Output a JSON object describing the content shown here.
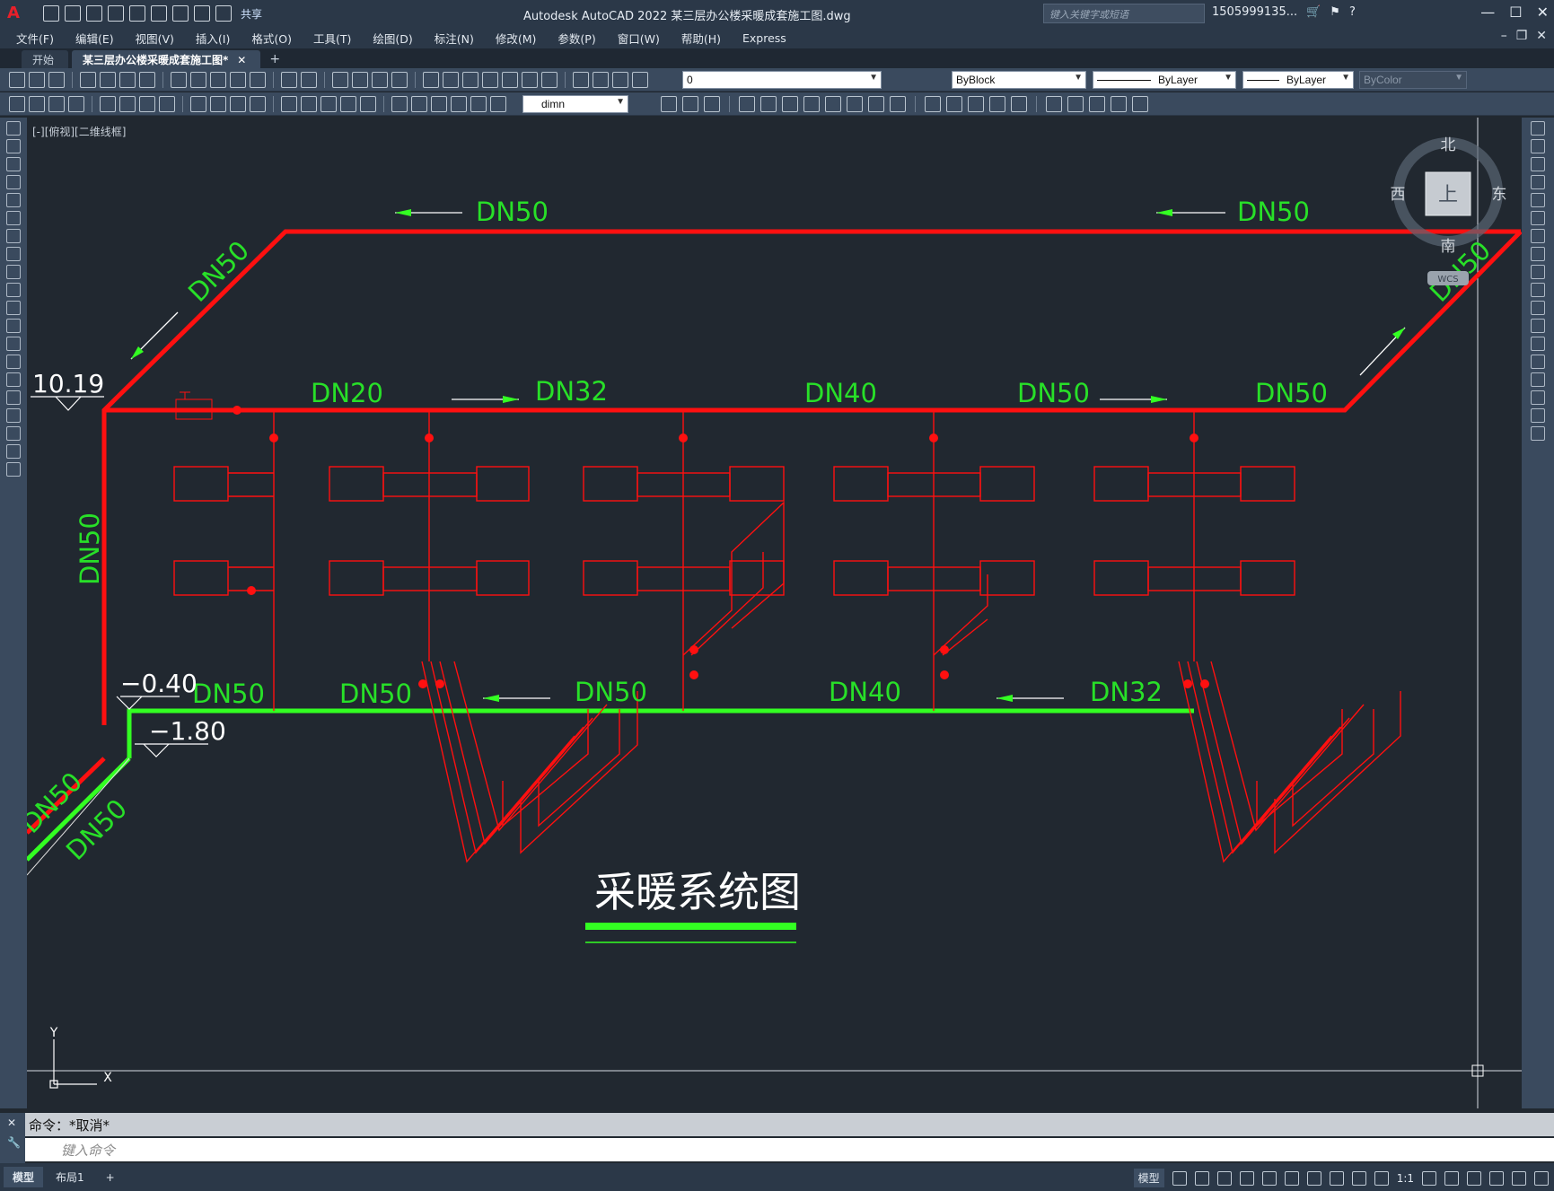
{
  "titlebar": {
    "share_label": "共享",
    "app_title": "Autodesk AutoCAD 2022    某三层办公楼采暖成套施工图.dwg",
    "search_placeholder": "键入关键字或短语",
    "user": "1505999135..."
  },
  "menus": [
    "文件(F)",
    "编辑(E)",
    "视图(V)",
    "插入(I)",
    "格式(O)",
    "工具(T)",
    "绘图(D)",
    "标注(N)",
    "修改(M)",
    "参数(P)",
    "窗口(W)",
    "帮助(H)",
    "Express"
  ],
  "tabs": {
    "start": "开始",
    "drawing": "某三层办公楼采暖成套施工图*"
  },
  "toolbar": {
    "layer_value": "0",
    "color_value": "ByBlock",
    "linetype_value": "ByLayer",
    "lineweight_value": "ByLayer",
    "plotstyle_value": "ByColor",
    "dimstyle_value": "dimn"
  },
  "viewport_label": "[-][俯视][二维线框]",
  "viewcube": {
    "north": "北",
    "south": "南",
    "east": "东",
    "west": "西",
    "face": "上",
    "wcs": "WCS"
  },
  "drawing": {
    "title": "采暖系统图",
    "elevations": {
      "top": "10.19",
      "minus040": "−0.40",
      "minus180": "−1.80"
    },
    "labels": {
      "top_left": "DN50",
      "top_right": "DN50",
      "diag_left": "DN50",
      "diag_right": "DN50",
      "supply1": "DN20",
      "supply2": "DN32",
      "supply3": "DN40",
      "supply4": "DN50",
      "supply5": "DN50",
      "riser": "DN50",
      "return0": "DN50",
      "return1": "DN50",
      "return2": "DN50",
      "return3": "DN40",
      "return4": "DN32",
      "bottom_red": "DN50",
      "bottom_green": "DN50"
    },
    "colors": {
      "supply": "#ff1010",
      "return": "#33ff22",
      "text": "#28e028",
      "bg": "#212830"
    }
  },
  "ucs": {
    "y": "Y",
    "x": "X"
  },
  "command": {
    "history": "命令：*取消*",
    "placeholder": "键入命令"
  },
  "statusbar": {
    "model_tab": "模型",
    "layout_tab": "布局1",
    "model_label": "模型",
    "scale": "1:1"
  }
}
